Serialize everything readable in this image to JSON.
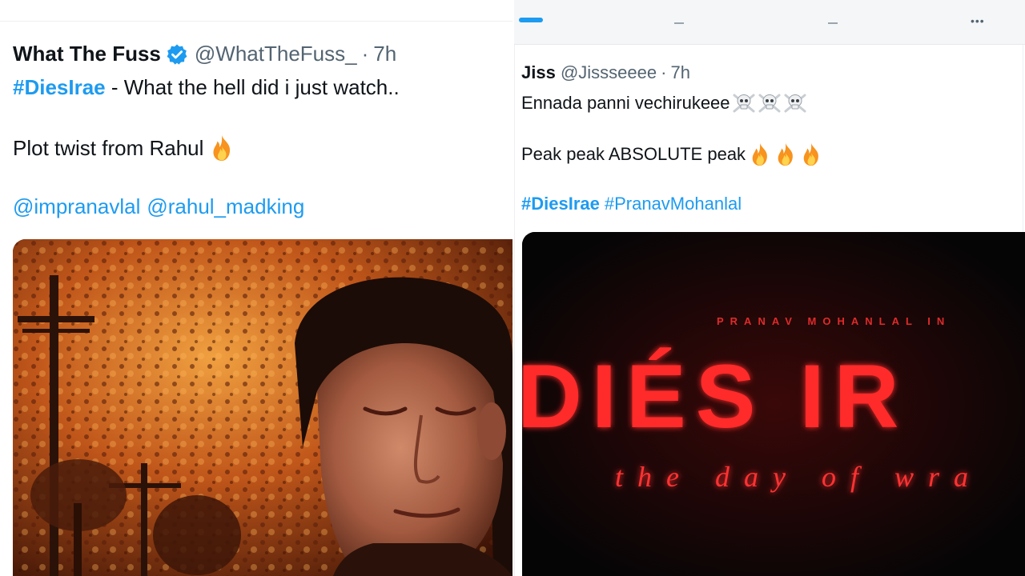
{
  "left_tweet": {
    "author_name": "What The Fuss",
    "handle": "@WhatTheFuss_",
    "time": "7h",
    "dot": "·",
    "hashtag": "#DiesIrae",
    "line1_rest": " - What the hell did i just watch..",
    "line2": "Plot twist from Rahul",
    "mentions": [
      "@impranavlal",
      "@rahul_madking"
    ],
    "verified_icon": "verified-badge-icon",
    "emoji": "fire-emoji"
  },
  "right_tweet": {
    "author_name": "Jiss",
    "handle": "@Jissseeee",
    "time": "7h",
    "dot": "·",
    "line1": "Ennada panni vechirukeee",
    "line1_emoji": "skull-crossbones-emoji",
    "line2": "Peak peak ABSOLUTE peak",
    "line2_emoji": "fire-emoji",
    "hashtags": [
      "#DiesIrae",
      "#PranavMohanlal"
    ]
  },
  "poster": {
    "top_credit": "PRANAV MOHANLAL IN",
    "title": "DIÉS IR",
    "tagline": "the day of wra"
  },
  "colors": {
    "link": "#1d9bf0",
    "muted": "#536471",
    "text": "#0f1419",
    "poster_red": "#ff2a2a"
  }
}
